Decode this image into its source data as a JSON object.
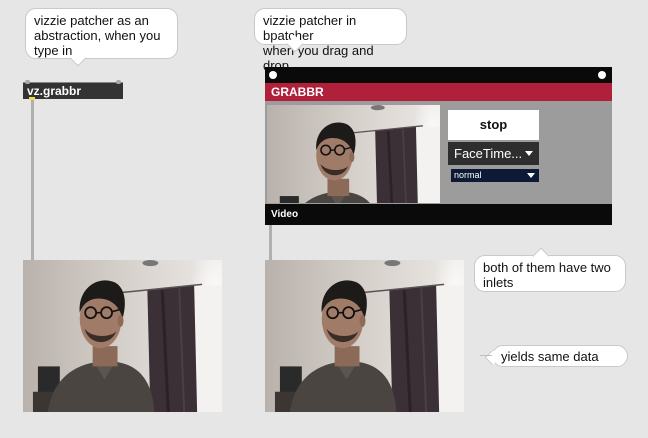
{
  "comments": {
    "abstraction": "vizzie patcher as an\nabstraction, when you\ntype in",
    "bpatcher": "vizzie patcher in bpatcher\nwhen you drag and drop",
    "inlets": "both of them have two\ninlets",
    "same_data": "yields same data"
  },
  "abstraction_object": {
    "label": "vz.grabbr"
  },
  "bpatcher": {
    "title": "GRABBR",
    "stop_label": "stop",
    "device_menu": "FaceTime...",
    "mode_menu": "normal",
    "footer": "Video"
  },
  "colors": {
    "canvas": "#e6e6e6",
    "title_bar": "#b0203a",
    "panel": "#9c9c9c",
    "outlet": "#e9dc4f"
  },
  "icons": {
    "menu_caret": "chevron-down-icon",
    "corner_dot": "circle-icon"
  }
}
